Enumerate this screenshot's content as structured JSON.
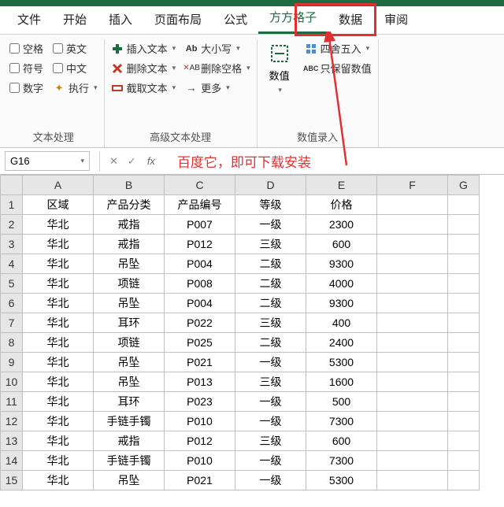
{
  "tabs": {
    "file": "文件",
    "home": "开始",
    "insert": "插入",
    "layout": "页面布局",
    "formula": "公式",
    "ffgz": "方方格子",
    "data": "数据",
    "review": "审阅"
  },
  "ribbon": {
    "text_proc": {
      "space": "空格",
      "english": "英文",
      "symbol": "符号",
      "chinese": "中文",
      "number": "数字",
      "execute": "执行",
      "group_label": "文本处理"
    },
    "adv_text": {
      "insert_text": "插入文本",
      "delete_text": "删除文本",
      "extract_text": "截取文本",
      "case": "大小写",
      "del_space": "删除空格",
      "more": "更多",
      "group_label": "高级文本处理"
    },
    "num": {
      "numeric": "数值",
      "round": "四舍五入",
      "keep_num": "只保留数值",
      "group_label": "数值录入"
    }
  },
  "namebox": {
    "cell": "G16"
  },
  "annotation": "百度它，即可下载安装",
  "columns": [
    "A",
    "B",
    "C",
    "D",
    "E",
    "F",
    "G"
  ],
  "headers": {
    "A": "区域",
    "B": "产品分类",
    "C": "产品编号",
    "D": "等级",
    "E": "价格"
  },
  "rows": [
    {
      "n": 1,
      "A": "区域",
      "B": "产品分类",
      "C": "产品编号",
      "D": "等级",
      "E": "价格"
    },
    {
      "n": 2,
      "A": "华北",
      "B": "戒指",
      "C": "P007",
      "D": "一级",
      "E": "2300"
    },
    {
      "n": 3,
      "A": "华北",
      "B": "戒指",
      "C": "P012",
      "D": "三级",
      "E": "600"
    },
    {
      "n": 4,
      "A": "华北",
      "B": "吊坠",
      "C": "P004",
      "D": "二级",
      "E": "9300"
    },
    {
      "n": 5,
      "A": "华北",
      "B": "项链",
      "C": "P008",
      "D": "二级",
      "E": "4000"
    },
    {
      "n": 6,
      "A": "华北",
      "B": "吊坠",
      "C": "P004",
      "D": "二级",
      "E": "9300"
    },
    {
      "n": 7,
      "A": "华北",
      "B": "耳环",
      "C": "P022",
      "D": "三级",
      "E": "400"
    },
    {
      "n": 8,
      "A": "华北",
      "B": "项链",
      "C": "P025",
      "D": "二级",
      "E": "2400"
    },
    {
      "n": 9,
      "A": "华北",
      "B": "吊坠",
      "C": "P021",
      "D": "一级",
      "E": "5300"
    },
    {
      "n": 10,
      "A": "华北",
      "B": "吊坠",
      "C": "P013",
      "D": "三级",
      "E": "1600"
    },
    {
      "n": 11,
      "A": "华北",
      "B": "耳环",
      "C": "P023",
      "D": "一级",
      "E": "500"
    },
    {
      "n": 12,
      "A": "华北",
      "B": "手链手镯",
      "C": "P010",
      "D": "一级",
      "E": "7300"
    },
    {
      "n": 13,
      "A": "华北",
      "B": "戒指",
      "C": "P012",
      "D": "三级",
      "E": "600"
    },
    {
      "n": 14,
      "A": "华北",
      "B": "手链手镯",
      "C": "P010",
      "D": "一级",
      "E": "7300"
    },
    {
      "n": 15,
      "A": "华北",
      "B": "吊坠",
      "C": "P021",
      "D": "一级",
      "E": "5300"
    }
  ]
}
